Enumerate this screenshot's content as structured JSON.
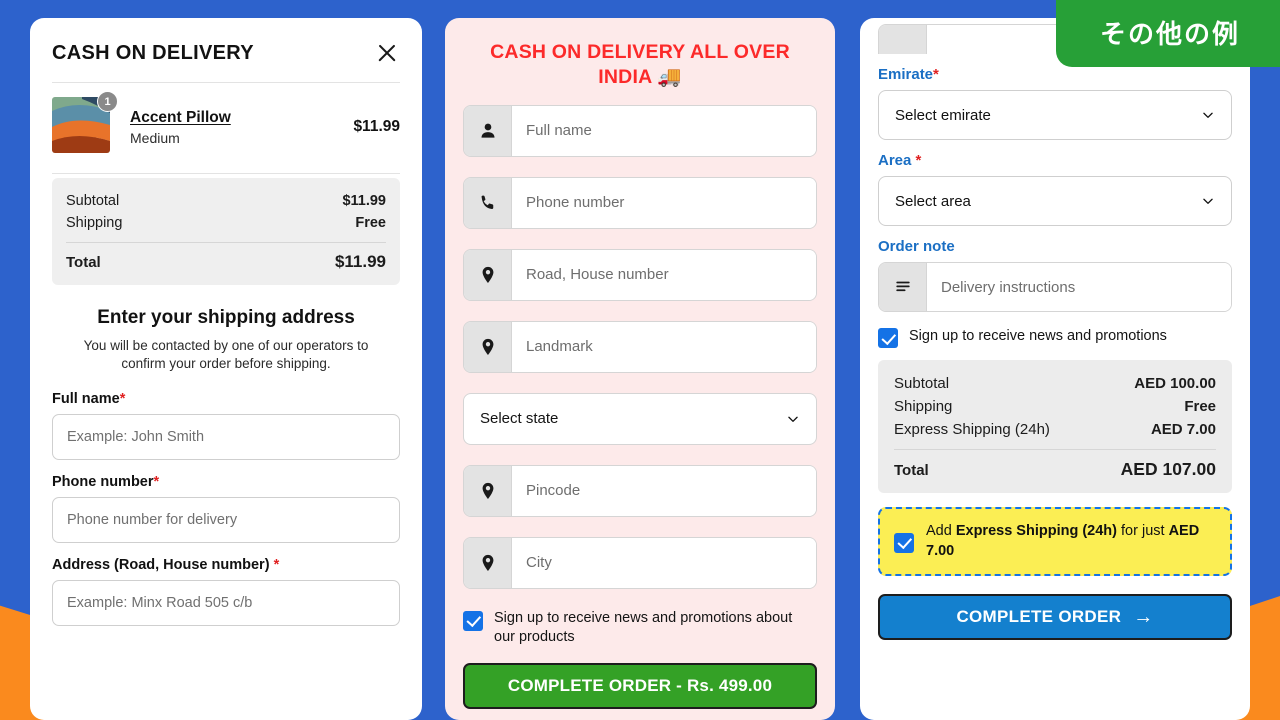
{
  "background": {
    "blue": "#2D62CC",
    "orange": "#FA8A1E"
  },
  "ribbon": {
    "label": "その他の例",
    "color": "#27A037"
  },
  "panel1": {
    "title": "CASH ON DELIVERY",
    "close_icon": "close-icon",
    "line_item": {
      "name": "Accent Pillow",
      "variant": "Medium",
      "price": "$11.99",
      "quantity": "1"
    },
    "totals": {
      "subtotal_label": "Subtotal",
      "subtotal_value": "$11.99",
      "shipping_label": "Shipping",
      "shipping_value": "Free",
      "total_label": "Total",
      "total_value": "$11.99"
    },
    "heading": "Enter your shipping address",
    "subheading": "You will be contacted by one of our operators to confirm your order before shipping.",
    "fields": [
      {
        "label": "Full name",
        "required": "*",
        "placeholder": "Example: John Smith"
      },
      {
        "label": "Phone number",
        "required": "*",
        "placeholder": "Phone number for delivery"
      },
      {
        "label": "Address (Road, House number)",
        "required": "*",
        "placeholder": "Example: Minx Road 505 c/b"
      }
    ]
  },
  "panel2": {
    "title": "CASH ON DELIVERY ALL OVER INDIA 🚚",
    "title_color": "#FC2A2A",
    "fields": [
      {
        "icon": "person-icon",
        "placeholder": "Full name"
      },
      {
        "icon": "phone-icon",
        "placeholder": "Phone number"
      },
      {
        "icon": "location-pin-icon",
        "placeholder": "Road, House number"
      },
      {
        "icon": "location-pin-icon",
        "placeholder": "Landmark"
      }
    ],
    "state_select": {
      "value": "Select state",
      "icon": "chevron-down-icon"
    },
    "fields2": [
      {
        "icon": "location-pin-icon",
        "placeholder": "Pincode"
      },
      {
        "icon": "location-pin-icon",
        "placeholder": "City"
      }
    ],
    "newsletter": {
      "checked": true,
      "label": "Sign up to receive news and promotions about our products"
    },
    "submit_label": "COMPLETE ORDER - Rs. 499.00",
    "submit_color": "#34A126"
  },
  "panel3": {
    "label_color": "#1B6FC4",
    "emirate": {
      "label": "Emirate",
      "required": "*",
      "value": "Select emirate"
    },
    "area": {
      "label": "Area",
      "required": "*",
      "value": "Select area"
    },
    "order_note": {
      "label": "Order note",
      "icon": "list-lines-icon",
      "placeholder": "Delivery instructions"
    },
    "newsletter": {
      "checked": true,
      "label": "Sign up to receive news and promotions"
    },
    "totals": {
      "rows": [
        {
          "label": "Subtotal",
          "value": "AED 100.00"
        },
        {
          "label": "Shipping",
          "value": "Free"
        },
        {
          "label": "Express Shipping (24h)",
          "value": "AED 7.00"
        }
      ],
      "total_label": "Total",
      "total_value": "AED 107.00"
    },
    "upsell": {
      "checked": true,
      "prefix": "Add ",
      "strong1": "Express Shipping (24h)",
      "middle": " for just ",
      "strong2": "AED 7.00",
      "bg": "#FBEE54",
      "border": "#1472E6"
    },
    "submit_label": "COMPLETE ORDER",
    "submit_arrow": "→",
    "submit_color": "#1480CE"
  }
}
